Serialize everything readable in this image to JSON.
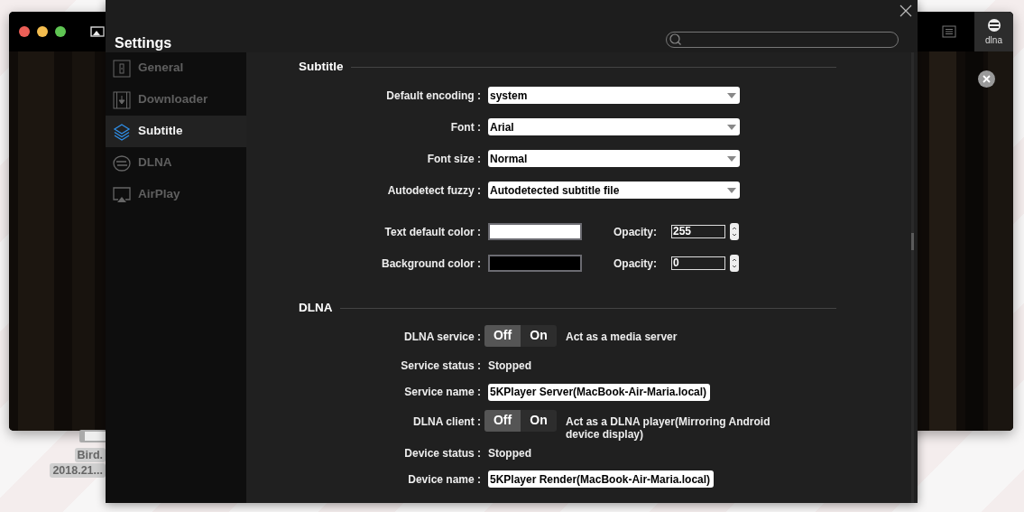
{
  "player_window": {
    "traffic_lights": [
      {
        "color": "#ec5f57"
      },
      {
        "color": "#f4bd4f"
      },
      {
        "color": "#5fc553"
      }
    ],
    "tabs": [
      {
        "kind": "list",
        "selected": false
      },
      {
        "kind": "dlna",
        "label": "dlna",
        "selected": true
      }
    ]
  },
  "desktop_icon": {
    "name": "Bird.",
    "date": "2018.21..."
  },
  "settings": {
    "title": "Settings",
    "sidebar": [
      {
        "kind": "general",
        "label": "General",
        "selected": false
      },
      {
        "kind": "downloader",
        "label": "Downloader",
        "selected": false
      },
      {
        "kind": "subtitle",
        "label": "Subtitle",
        "selected": true
      },
      {
        "kind": "dlna",
        "label": "DLNA",
        "selected": false
      },
      {
        "kind": "airplay",
        "label": "AirPlay",
        "selected": false
      }
    ],
    "sections": [
      {
        "title": "Subtitle",
        "rows": [
          {
            "kind": "select",
            "label": "Default encoding :",
            "value": "system"
          },
          {
            "kind": "select",
            "label": "Font :",
            "value": "Arial"
          },
          {
            "kind": "select",
            "label": "Font size :",
            "value": "Normal"
          },
          {
            "kind": "select",
            "label": "Autodetect fuzzy :",
            "value": "Autodetected subtitle file"
          },
          {
            "kind": "color",
            "label": "Text default color :",
            "color": "#ffffff",
            "opacity_label": "Opacity:",
            "opacity": "255"
          },
          {
            "kind": "color",
            "label": "Background color :",
            "color": "#000000",
            "opacity_label": "Opacity:",
            "opacity": "0"
          }
        ]
      },
      {
        "title": "DLNA",
        "rows": [
          {
            "kind": "toggle",
            "label": "DLNA service :",
            "off": "Off",
            "on_label": "On",
            "on": false,
            "description": "Act as a media server"
          },
          {
            "kind": "text",
            "label": "Service status :",
            "value": "Stopped"
          },
          {
            "kind": "input",
            "label": "Service name :",
            "value": "5KPlayer Server(MacBook-Air-Maria.local)"
          },
          {
            "kind": "toggle",
            "label": "DLNA client :",
            "off": "Off",
            "on_label": "On",
            "on": false,
            "description": "Act as a DLNA player(Mirroring Android device display)"
          },
          {
            "kind": "text",
            "label": "Device status :",
            "value": "Stopped"
          },
          {
            "kind": "input",
            "label": "Device name :",
            "value": "5KPlayer Render(MacBook-Air-Maria.local)"
          }
        ]
      }
    ]
  }
}
